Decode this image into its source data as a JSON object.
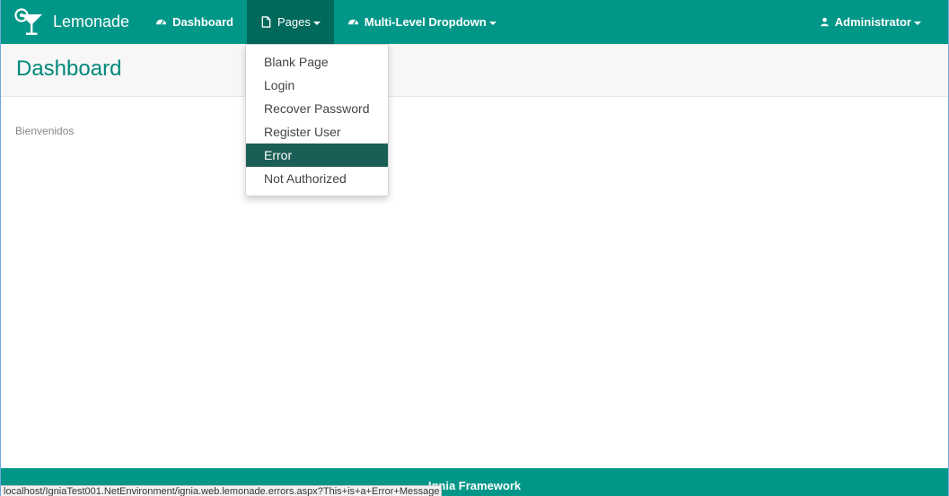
{
  "navbar": {
    "brand": "Lemonade",
    "items": [
      {
        "label": "Dashboard",
        "icon": "dashboard-icon"
      },
      {
        "label": "Pages",
        "icon": "file-icon"
      },
      {
        "label": "Multi-Level Dropdown",
        "icon": "dashboard-icon"
      }
    ],
    "user": {
      "label": "Administrator",
      "icon": "user-icon"
    }
  },
  "page": {
    "title": "Dashboard",
    "welcome": "Bienvenidos"
  },
  "pages_dropdown": {
    "items": [
      {
        "label": "Blank Page"
      },
      {
        "label": "Login"
      },
      {
        "label": "Recover Password"
      },
      {
        "label": "Register User"
      },
      {
        "label": "Error"
      },
      {
        "label": "Not Authorized"
      }
    ],
    "highlighted": "Error"
  },
  "footer": {
    "text": "Ignia Framework"
  },
  "status_bar": {
    "url": "localhost/IgniaTest001.NetEnvironment/ignia.web.lemonade.errors.aspx?This+is+a+Error+Message"
  },
  "colors": {
    "primary": "#009688",
    "primary_dark": "#00695c",
    "highlight": "#1a5e56",
    "title": "#00897b"
  }
}
